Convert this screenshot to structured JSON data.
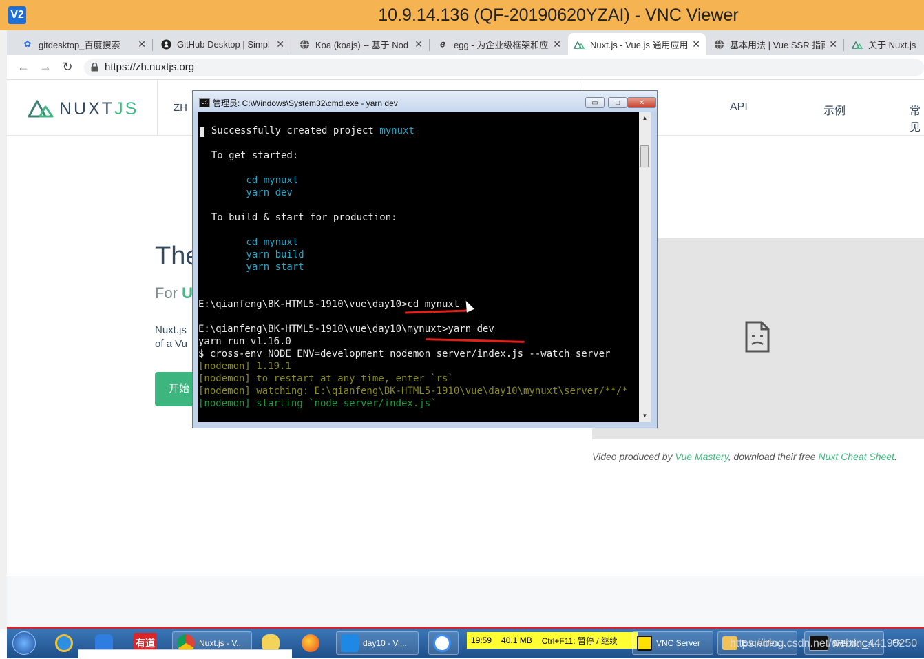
{
  "vnc": {
    "logo": "V2",
    "title": "10.9.14.136 (QF-20190620YZAI) - VNC Viewer"
  },
  "browser": {
    "tabs": [
      {
        "icon": "baidu-paw-icon",
        "label": "gitdesktop_百度搜索"
      },
      {
        "icon": "github-icon",
        "label": "GitHub Desktop | Simpl"
      },
      {
        "icon": "globe-icon",
        "label": "Koa (koajs) -- 基于 Nod"
      },
      {
        "icon": "egg-icon",
        "label": "egg - 为企业级框架和应用"
      },
      {
        "icon": "nuxt-icon",
        "label": "Nuxt.js - Vue.js 通用应用"
      },
      {
        "icon": "globe-icon",
        "label": "基本用法 | Vue SSR 指南"
      },
      {
        "icon": "nuxt-icon",
        "label": "关于 Nuxt.js -"
      }
    ],
    "close_glyph": "✕",
    "url": "https://zh.nuxtjs.org"
  },
  "nuxt": {
    "logo_main": "NUXT",
    "logo_js": "JS",
    "lang": "ZH",
    "nav": [
      "API",
      "示例",
      "常见"
    ],
    "hero_title": "The",
    "hero_sub_prefix": "For ",
    "hero_sub_green": "U",
    "hero_desc_line1": "Nuxt.js",
    "hero_desc_line2": "of a Vu",
    "start_button": "开始",
    "video_credit_1": "Video produced by ",
    "video_credit_link1": "Vue Mastery",
    "video_credit_2": ", download their free ",
    "video_credit_link2": "Nuxt Cheat Sheet",
    "video_credit_3": "."
  },
  "cmd": {
    "title": "管理员: C:\\Windows\\System32\\cmd.exe - yarn  dev",
    "minimize": "▭",
    "maximize": "□",
    "close": "✕",
    "lines": {
      "l1_a": "  Successfully created project ",
      "l1_b": "mynuxt",
      "l2": "  To get started:",
      "l3": "        cd mynuxt",
      "l4": "        yarn dev",
      "l5": "  To build & start for production:",
      "l6": "        cd mynuxt",
      "l7": "        yarn build",
      "l8": "        yarn start",
      "l9": "E:\\qianfeng\\BK-HTML5-1910\\vue\\day10>cd mynuxt",
      "l10": "E:\\qianfeng\\BK-HTML5-1910\\vue\\day10\\mynuxt>yarn dev",
      "l11": "yarn run v1.16.0",
      "l12": "$ cross-env NODE_ENV=development nodemon server/index.js --watch server",
      "l13": "[nodemon] 1.19.1",
      "l14": "[nodemon] to restart at any time, enter `rs`",
      "l15": "[nodemon] watching: E:\\qianfeng\\BK-HTML5-1910\\vue\\day10\\mynuxt\\server/**/*",
      "l16": "[nodemon] starting `node server/index.js`"
    }
  },
  "taskbar": {
    "items": [
      {
        "label": ""
      },
      {
        "label": ""
      },
      {
        "label": ""
      },
      {
        "label": "有道"
      },
      {
        "label": "Nuxt.js - V..."
      },
      {
        "label": ""
      },
      {
        "label": ""
      },
      {
        "label": "day10 - Vi..."
      },
      {
        "label": ""
      },
      {
        "label": "VNC Server"
      },
      {
        "label": "E:\\qianfen..."
      },
      {
        "label": "管理员: C:\\..."
      },
      {
        "label": "EN"
      }
    ],
    "status_time": "19:59",
    "status_size": "40.1 MB",
    "status_hint": "Ctrl+F11: 暂停 / 继续",
    "watermark": "https://blog.csdn.net/weixin_44195250"
  }
}
